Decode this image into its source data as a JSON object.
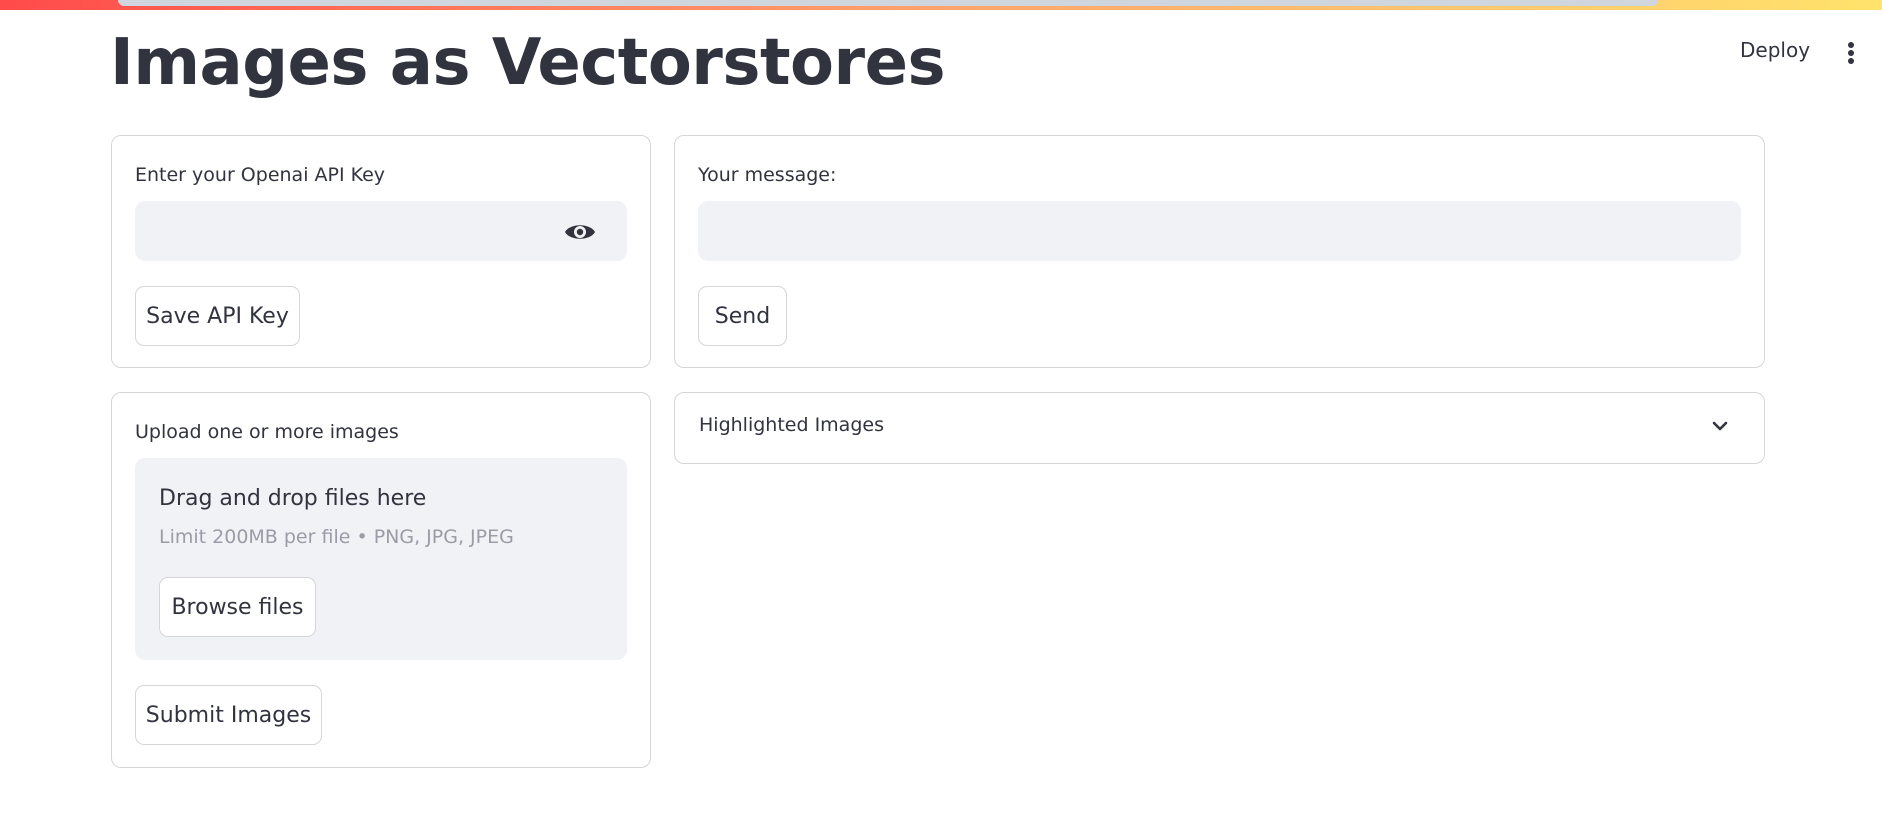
{
  "header": {
    "deploy_label": "Deploy",
    "menu_icon": "kebab-menu-icon"
  },
  "page": {
    "title": "Images as Vectorstores"
  },
  "api_key_card": {
    "label": "Enter your Openai API Key",
    "value": "",
    "toggle_icon": "eye-icon",
    "save_label": "Save API Key"
  },
  "message_card": {
    "label": "Your message:",
    "value": "",
    "send_label": "Send"
  },
  "upload_card": {
    "label": "Upload one or more images",
    "dropzone_title": "Drag and drop files here",
    "dropzone_limit": "Limit 200MB per file • PNG, JPG, JPEG",
    "browse_label": "Browse files",
    "submit_label": "Submit Images"
  },
  "highlighted_expander": {
    "label": "Highlighted Images",
    "icon": "chevron-down-icon"
  },
  "colors": {
    "text": "#31333F",
    "input_bg": "#f0f2f6",
    "border": "#d6d6d9",
    "muted": "#9a9ca7",
    "accent": "#ff4b4b"
  }
}
